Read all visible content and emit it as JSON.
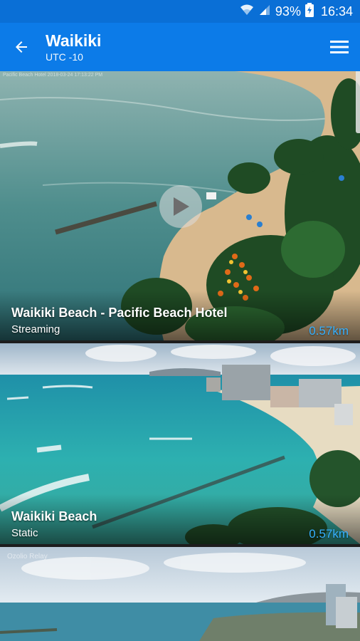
{
  "status_bar": {
    "battery_percent": "93%",
    "time": "16:34",
    "icons": [
      "wifi-icon",
      "signal-icon",
      "battery-icon"
    ]
  },
  "app_bar": {
    "title": "Waikiki",
    "subtitle": "UTC -10",
    "back_icon": "arrow-back-icon",
    "menu_icon": "hamburger-menu-icon"
  },
  "cameras": [
    {
      "name": "Waikiki Beach - Pacific Beach Hotel",
      "type": "Streaming",
      "distance": "0.57km",
      "watermark": "Pacific Beach Hotel 2018-03-24 17:13:22 PM"
    },
    {
      "name": "Waikiki Beach",
      "type": "Static",
      "distance": "0.57km"
    },
    {
      "watermark": "Ozolio Relay"
    }
  ],
  "colors": {
    "app_bar": "#0c7be8",
    "status_bar": "#0a6fd6",
    "distance_text": "#35b0ff"
  }
}
